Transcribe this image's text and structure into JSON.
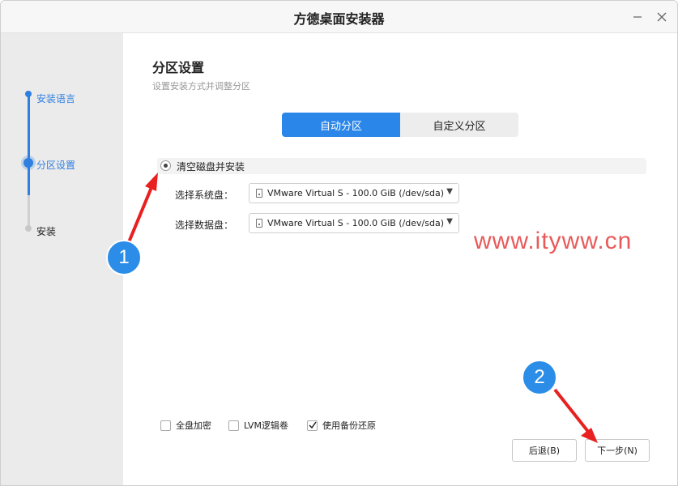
{
  "window": {
    "title": "方德桌面安装器",
    "minimize_icon": "minimize-icon",
    "close_icon": "close-icon"
  },
  "sidebar": {
    "steps": [
      {
        "label": "安装语言",
        "state": "done"
      },
      {
        "label": "分区设置",
        "state": "current"
      },
      {
        "label": "安装",
        "state": "pending"
      }
    ]
  },
  "main": {
    "title": "分区设置",
    "subtitle": "设置安装方式并调整分区",
    "tabs": [
      {
        "label": "自动分区",
        "active": true
      },
      {
        "label": "自定义分区",
        "active": false
      }
    ],
    "option": {
      "label": "清空磁盘并安装",
      "selected": true
    },
    "system_disk": {
      "label": "选择系统盘：",
      "value": "VMware Virtual S - 100.0 GiB (/dev/sda)"
    },
    "data_disk": {
      "label": "选择数据盘：",
      "value": "VMware Virtual S - 100.0 GiB (/dev/sda)"
    },
    "checks": [
      {
        "label": "全盘加密",
        "checked": false
      },
      {
        "label": "LVM逻辑卷",
        "checked": false
      },
      {
        "label": "使用备份还原",
        "checked": true
      }
    ],
    "back_button": "后退(B)",
    "next_button": "下一步(N)"
  },
  "annotations": {
    "badge1": "1",
    "badge2": "2",
    "watermark": "www.ityww.cn"
  },
  "colors": {
    "accent": "#2a86e8",
    "arrow": "#e82020",
    "watermark": "#e85a5a"
  }
}
